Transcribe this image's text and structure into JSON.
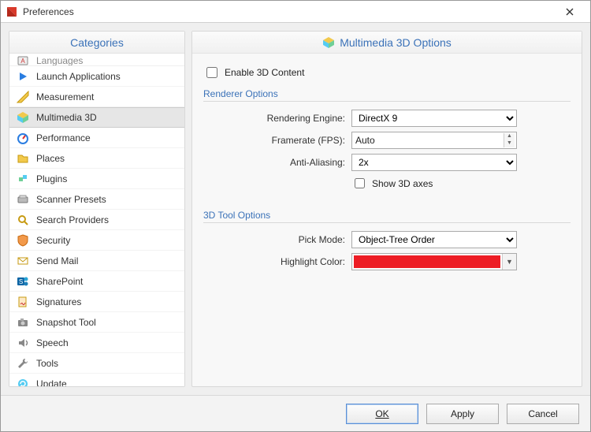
{
  "window": {
    "title": "Preferences"
  },
  "categories_header": "Categories",
  "categories": [
    {
      "label": "Languages",
      "icon": "languages-icon",
      "cut": true
    },
    {
      "label": "Launch Applications",
      "icon": "launch-icon"
    },
    {
      "label": "Measurement",
      "icon": "measurement-icon"
    },
    {
      "label": "Multimedia 3D",
      "icon": "multimedia3d-icon",
      "selected": true
    },
    {
      "label": "Performance",
      "icon": "performance-icon"
    },
    {
      "label": "Places",
      "icon": "places-icon"
    },
    {
      "label": "Plugins",
      "icon": "plugins-icon"
    },
    {
      "label": "Scanner Presets",
      "icon": "scanner-icon"
    },
    {
      "label": "Search Providers",
      "icon": "search-providers-icon"
    },
    {
      "label": "Security",
      "icon": "security-icon"
    },
    {
      "label": "Send Mail",
      "icon": "sendmail-icon"
    },
    {
      "label": "SharePoint",
      "icon": "sharepoint-icon"
    },
    {
      "label": "Signatures",
      "icon": "signatures-icon"
    },
    {
      "label": "Snapshot Tool",
      "icon": "snapshot-icon"
    },
    {
      "label": "Speech",
      "icon": "speech-icon"
    },
    {
      "label": "Tools",
      "icon": "tools-icon"
    },
    {
      "label": "Update",
      "icon": "update-icon"
    }
  ],
  "main": {
    "header": "Multimedia 3D Options",
    "enable3d_label": "Enable 3D Content",
    "enable3d_checked": false,
    "renderer_group": "Renderer Options",
    "rendering_engine_label": "Rendering Engine:",
    "rendering_engine_value": "DirectX 9",
    "framerate_label": "Framerate (FPS):",
    "framerate_value": "Auto",
    "anti_aliasing_label": "Anti-Aliasing:",
    "anti_aliasing_value": "2x",
    "show_axes_label": "Show 3D axes",
    "show_axes_checked": false,
    "tool_group": "3D Tool Options",
    "pick_mode_label": "Pick Mode:",
    "pick_mode_value": "Object-Tree Order",
    "highlight_color_label": "Highlight Color:",
    "highlight_color_value": "#ed1c24"
  },
  "footer": {
    "ok": "OK",
    "apply": "Apply",
    "cancel": "Cancel"
  }
}
